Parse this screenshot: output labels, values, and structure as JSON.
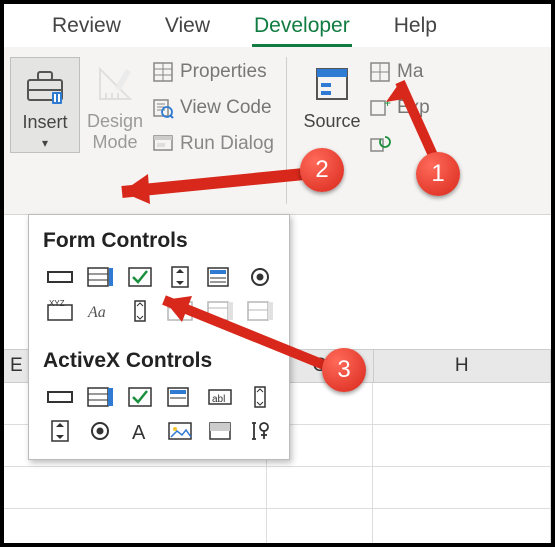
{
  "tabs": {
    "review": "Review",
    "view": "View",
    "developer": "Developer",
    "help": "Help"
  },
  "ribbon": {
    "insert": "Insert",
    "design_mode": "Design\nMode",
    "properties": "Properties",
    "view_code": "View Code",
    "run_dialog": "Run Dialog",
    "source": "Source",
    "map": "Ma",
    "exp": "Exp"
  },
  "dropdown": {
    "form_controls": "Form Controls",
    "activex_controls": "ActiveX Controls"
  },
  "columns": {
    "g": "G",
    "h": "H",
    "e": "E"
  },
  "callouts": {
    "one": "1",
    "two": "2",
    "three": "3"
  }
}
